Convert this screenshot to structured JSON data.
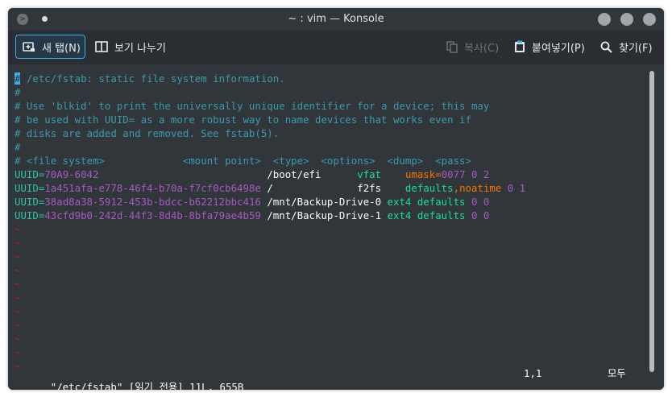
{
  "window": {
    "title": "~ : vim — Konsole"
  },
  "toolbar": {
    "new_tab": "새 탭(N)",
    "split_view": "보기 나누기",
    "copy": "복사(C)",
    "paste": "붙여넣기(P)",
    "find": "찾기(F)"
  },
  "editor": {
    "lines": [
      {
        "segments": [
          {
            "cls": "cursor",
            "text": "#"
          },
          {
            "cls": "cmt",
            "text": " /etc/fstab: static file system information."
          }
        ]
      },
      {
        "segments": [
          {
            "cls": "cmt",
            "text": "#"
          }
        ]
      },
      {
        "segments": [
          {
            "cls": "cmt",
            "text": "# Use 'blkid' to print the universally unique identifier for a device; this may"
          }
        ]
      },
      {
        "segments": [
          {
            "cls": "cmt",
            "text": "# be used with UUID= as a more robust way to name devices that works even if"
          }
        ]
      },
      {
        "segments": [
          {
            "cls": "cmt",
            "text": "# disks are added and removed. See fstab(5)."
          }
        ]
      },
      {
        "segments": [
          {
            "cls": "cmt",
            "text": "#"
          }
        ]
      },
      {
        "segments": [
          {
            "cls": "cmt",
            "text": "# <file system>             <mount point>  <type>  <options>  <dump>  <pass>"
          }
        ]
      },
      {
        "segments": [
          {
            "cls": "key",
            "text": "UUID="
          },
          {
            "cls": "uuid",
            "text": "70A9-6042"
          },
          {
            "cls": "",
            "text": "                            /boot/efi      "
          },
          {
            "cls": "fstype",
            "text": "vfat"
          },
          {
            "cls": "",
            "text": "    "
          },
          {
            "cls": "opt-o",
            "text": "umask="
          },
          {
            "cls": "opt-p",
            "text": "0077 0 2"
          }
        ]
      },
      {
        "segments": [
          {
            "cls": "key",
            "text": "UUID="
          },
          {
            "cls": "uuid",
            "text": "1a451afa-e778-46f4-b70a-f7cf0cb6498e"
          },
          {
            "cls": "",
            "text": " /              f2fs    "
          },
          {
            "cls": "fstype",
            "text": "defaults"
          },
          {
            "cls": "opt-o",
            "text": ",noatime"
          },
          {
            "cls": "opt-p",
            "text": " 0 1"
          }
        ]
      },
      {
        "segments": [
          {
            "cls": "key",
            "text": "UUID="
          },
          {
            "cls": "uuid",
            "text": "38ad8a38-5912-453b-bdcc-b62212bbc416"
          },
          {
            "cls": "",
            "text": " /mnt/Backup-Drive-0 "
          },
          {
            "cls": "fstype",
            "text": "ext4 defaults"
          },
          {
            "cls": "opt-p",
            "text": " 0 0"
          }
        ]
      },
      {
        "segments": [
          {
            "cls": "key",
            "text": "UUID="
          },
          {
            "cls": "uuid",
            "text": "43cfd9b0-242d-44f3-8d4b-8bfa79ae4b59"
          },
          {
            "cls": "",
            "text": " /mnt/Backup-Drive-1 "
          },
          {
            "cls": "fstype",
            "text": "ext4 defaults"
          },
          {
            "cls": "opt-p",
            "text": " 0 0"
          }
        ]
      },
      {
        "segments": [
          {
            "cls": "tilde",
            "text": "~"
          }
        ]
      },
      {
        "segments": [
          {
            "cls": "tilde",
            "text": "~"
          }
        ]
      },
      {
        "segments": [
          {
            "cls": "tilde",
            "text": "~"
          }
        ]
      },
      {
        "segments": [
          {
            "cls": "tilde",
            "text": "~"
          }
        ]
      },
      {
        "segments": [
          {
            "cls": "tilde",
            "text": "~"
          }
        ]
      },
      {
        "segments": [
          {
            "cls": "tilde",
            "text": "~"
          }
        ]
      },
      {
        "segments": [
          {
            "cls": "tilde",
            "text": "~"
          }
        ]
      },
      {
        "segments": [
          {
            "cls": "tilde",
            "text": "~"
          }
        ]
      },
      {
        "segments": [
          {
            "cls": "tilde",
            "text": "~"
          }
        ]
      },
      {
        "segments": [
          {
            "cls": "tilde",
            "text": "~"
          }
        ]
      },
      {
        "segments": [
          {
            "cls": "tilde",
            "text": "~"
          }
        ]
      }
    ],
    "status": {
      "file": "\"/etc/fstab\" [읽기 전용] 11L, 655B",
      "position": "1,1",
      "scroll": "모두"
    }
  }
}
